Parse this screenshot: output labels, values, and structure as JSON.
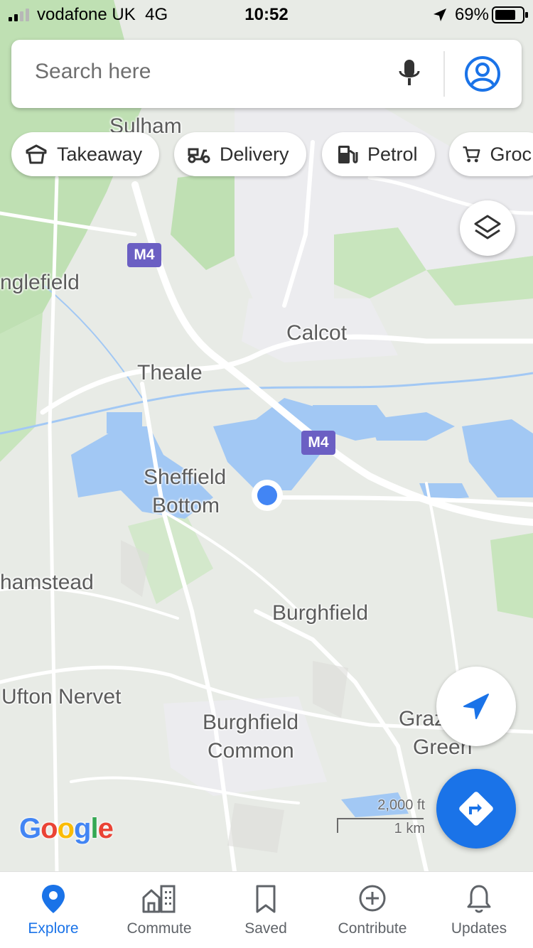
{
  "status_bar": {
    "carrier": "vodafone UK",
    "network": "4G",
    "time": "10:52",
    "battery_percent": "69%"
  },
  "search": {
    "placeholder": "Search here",
    "mic_icon": "microphone-icon",
    "account_icon": "account-circle-icon"
  },
  "chips": [
    {
      "label": "Takeaway",
      "icon": "takeaway-icon"
    },
    {
      "label": "Delivery",
      "icon": "delivery-scooter-icon"
    },
    {
      "label": "Petrol",
      "icon": "petrol-pump-icon"
    },
    {
      "label": "Groc",
      "icon": "shopping-cart-icon"
    }
  ],
  "map": {
    "places": {
      "sulham": "Sulham",
      "englefield": "nglefield",
      "calcot": "Calcot",
      "theale": "Theale",
      "sheffield_bottom_1": "Sheffield",
      "sheffield_bottom_2": "Bottom",
      "hamstead": "hamstead",
      "burghfield": "Burghfield",
      "ufton_nervet": "Ufton Nervet",
      "burghfield_common_1": "Burghfield",
      "burghfield_common_2": "Common",
      "grazeley_1": "Grazeley",
      "grazeley_2": "Green"
    },
    "road_shields": [
      "M4",
      "M4"
    ],
    "scale": {
      "imperial": "2,000 ft",
      "metric": "1 km"
    },
    "logo": "Google",
    "colors": {
      "land": "#e8ebe6",
      "woodland": "#bfe0b3",
      "water": "#a2c8f4",
      "road": "#ffffff",
      "motorway_shield": "#6b5fc3",
      "location_dot": "#4285f4"
    }
  },
  "buttons": {
    "layers_icon": "layers-icon",
    "my_location_icon": "navigation-arrow-icon",
    "directions_icon": "directions-icon"
  },
  "bottom_nav": [
    {
      "label": "Explore",
      "icon": "location-pin-icon",
      "active": true
    },
    {
      "label": "Commute",
      "icon": "commute-buildings-icon",
      "active": false
    },
    {
      "label": "Saved",
      "icon": "bookmark-icon",
      "active": false
    },
    {
      "label": "Contribute",
      "icon": "add-circle-icon",
      "active": false
    },
    {
      "label": "Updates",
      "icon": "bell-icon",
      "active": false
    }
  ],
  "accent_color": "#1a73e8"
}
